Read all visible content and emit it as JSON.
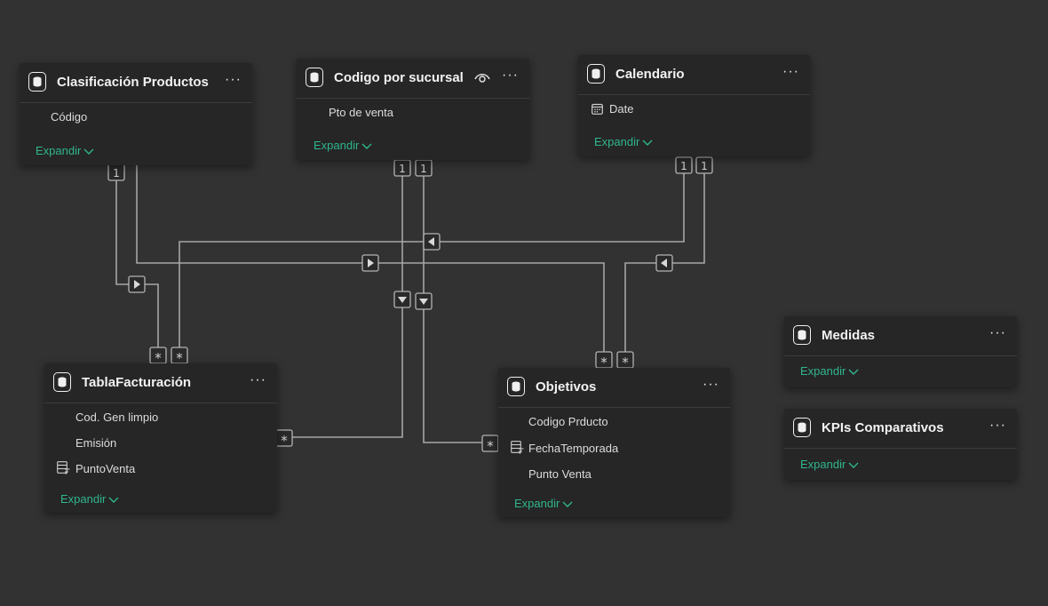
{
  "canvas": {
    "background": "#323232"
  },
  "colors": {
    "accent_expand": "#2fb68e",
    "card_bg": "#262626",
    "line": "#a6a6a6"
  },
  "tables": {
    "clasificacion": {
      "title": "Clasificación Productos",
      "fields": [
        "Código"
      ],
      "expand_label": "Expandir",
      "more_label": "···"
    },
    "sucursal": {
      "title": "Codigo por sucursal",
      "fields": [
        "Pto de venta"
      ],
      "expand_label": "Expandir",
      "more_label": "···",
      "icon": "eye-icon"
    },
    "calendario": {
      "title": "Calendario",
      "fields": [
        "Date"
      ],
      "expand_label": "Expandir",
      "more_label": "···",
      "field_icon": "calendar-icon"
    },
    "facturacion": {
      "title": "TablaFacturación",
      "fields": [
        "Cod. Gen limpio",
        "Emisión",
        "PuntoVenta"
      ],
      "expand_label": "Expandir",
      "more_label": "···",
      "field_icon": "calculated-column-icon"
    },
    "objetivos": {
      "title": "Objetivos",
      "fields": [
        "Codigo Prducto",
        "FechaTemporada",
        "Punto Venta"
      ],
      "expand_label": "Expandir",
      "more_label": "···",
      "field_icon": "calculated-column-icon"
    },
    "medidas": {
      "title": "Medidas",
      "expand_label": "Expandir",
      "more_label": "···"
    },
    "kpis": {
      "title": "KPIs Comparativos",
      "expand_label": "Expandir",
      "more_label": "···"
    }
  },
  "relationships": [
    {
      "from": "Clasificación Productos",
      "to": "TablaFacturación",
      "from_card": "1",
      "to_card": "*"
    },
    {
      "from": "Clasificación Productos",
      "to": "Objetivos",
      "from_card": "1",
      "to_card": "*"
    },
    {
      "from": "Codigo por sucursal",
      "to": "TablaFacturación",
      "from_card": "1",
      "to_card": "*"
    },
    {
      "from": "Codigo por sucursal",
      "to": "Objetivos",
      "from_card": "1",
      "to_card": "*"
    },
    {
      "from": "Calendario",
      "to": "TablaFacturación",
      "from_card": "1",
      "to_card": "*"
    },
    {
      "from": "Calendario",
      "to": "Objetivos",
      "from_card": "1",
      "to_card": "*"
    }
  ],
  "markers": {
    "one": "1",
    "many": "*"
  }
}
